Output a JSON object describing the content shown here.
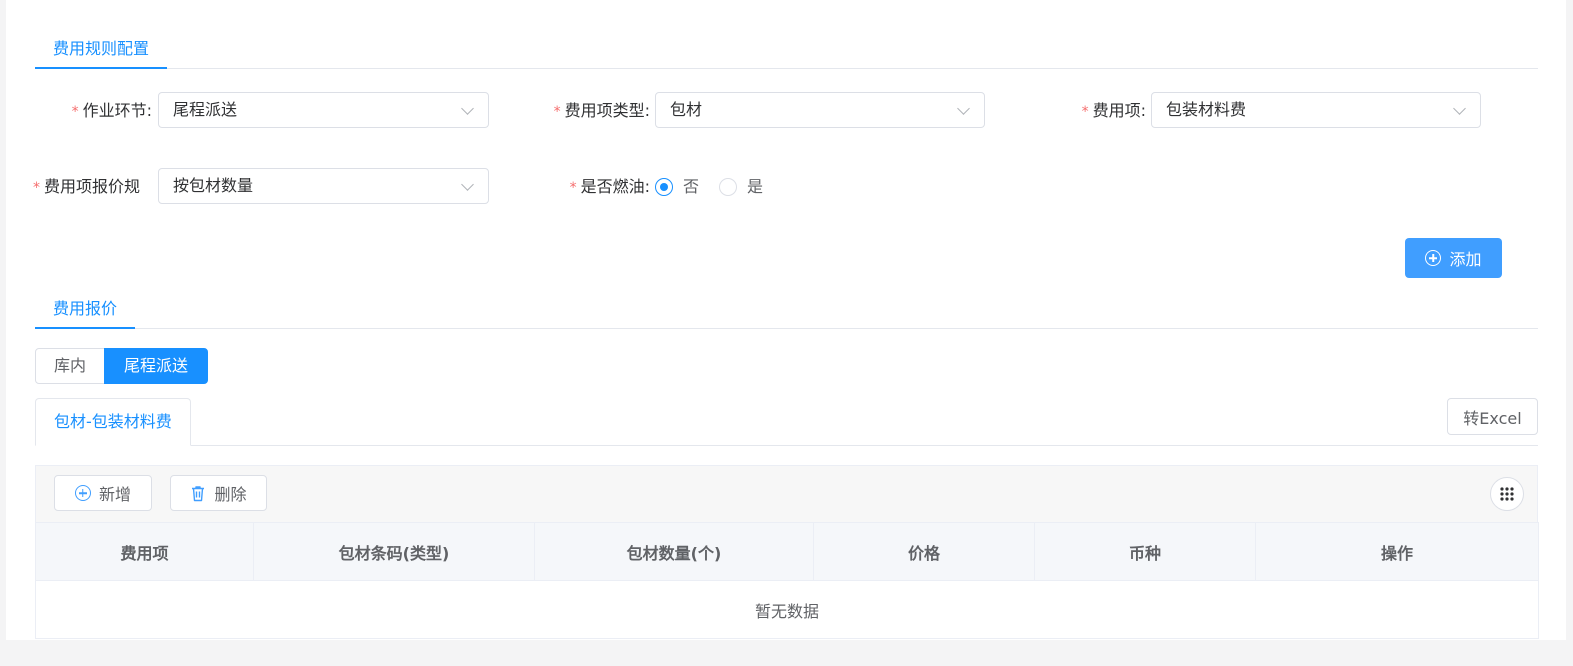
{
  "rule_tab": {
    "label": "费用规则配置"
  },
  "form": {
    "operation_stage": {
      "label": "作业环节:",
      "value": "尾程派送"
    },
    "fee_item_type": {
      "label": "费用项类型:",
      "value": "包材"
    },
    "fee_item": {
      "label": "费用项:",
      "value": "包装材料费"
    },
    "pricing_rule": {
      "label": "费用项报价规",
      "value": "按包材数量"
    },
    "fuel": {
      "label": "是否燃油:",
      "options": [
        {
          "label": "否",
          "selected": true
        },
        {
          "label": "是",
          "selected": false
        }
      ]
    },
    "add_button": "添加"
  },
  "quote_tab": {
    "label": "费用报价"
  },
  "segments": [
    {
      "label": "库内",
      "active": false
    },
    {
      "label": "尾程派送",
      "active": true
    }
  ],
  "card_tab": {
    "label": "包材-包装材料费"
  },
  "excel_button": "转Excel",
  "toolbar": {
    "add_label": "新增",
    "delete_label": "删除"
  },
  "table": {
    "columns": [
      "费用项",
      "包材条码(类型)",
      "包材数量(个)",
      "价格",
      "币种",
      "操作"
    ],
    "rows": [],
    "empty_text": "暂无数据"
  },
  "colors": {
    "primary": "#1890ff",
    "required": "#f56c6c"
  }
}
